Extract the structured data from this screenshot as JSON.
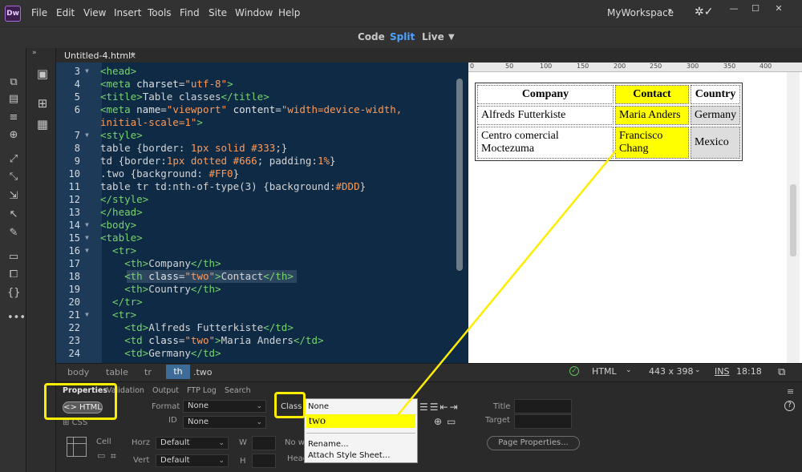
{
  "app": {
    "logo": "Dw",
    "menus": [
      "File",
      "Edit",
      "View",
      "Insert",
      "Tools",
      "Find",
      "Site",
      "Window",
      "Help"
    ],
    "workspace": "MyWorkspace",
    "window_controls": [
      "—",
      "☐",
      "✕"
    ]
  },
  "viewbar": {
    "code": "Code",
    "split": "Split",
    "live": "Live"
  },
  "document": {
    "tab_title": "Untitled-4.html*",
    "close": "×"
  },
  "code_lines": [
    {
      "n": "3"
    },
    {
      "n": "4"
    },
    {
      "n": "5"
    },
    {
      "n": "6"
    },
    {
      "n": ""
    },
    {
      "n": "7"
    },
    {
      "n": "8"
    },
    {
      "n": "9"
    },
    {
      "n": "10"
    },
    {
      "n": "11"
    },
    {
      "n": "12"
    },
    {
      "n": "13"
    },
    {
      "n": "14"
    },
    {
      "n": "15"
    },
    {
      "n": "16"
    },
    {
      "n": "17"
    },
    {
      "n": "18"
    },
    {
      "n": "19"
    },
    {
      "n": "20"
    },
    {
      "n": "21"
    },
    {
      "n": "22"
    },
    {
      "n": "23"
    },
    {
      "n": "24"
    }
  ],
  "code": {
    "l3": "<head>",
    "l4a": "<meta ",
    "l4b": "charset",
    "l4c": "=",
    "l4d": "\"utf-8\"",
    "l4e": ">",
    "l5a": "<title>",
    "l5b": "Table classes",
    "l5c": "</title>",
    "l6a": "<meta ",
    "l6b": "name",
    "l6c": "=",
    "l6d": "\"viewport\"",
    "l6e": " content",
    "l6f": "=",
    "l6g": "\"width=device-width,",
    "l6h": "initial-scale=1\"",
    "l6i": ">",
    "l7": "<style>",
    "l8a": "table {border: ",
    "l8b": "1px solid #333",
    "l8c": ";}",
    "l9a": "td {border:",
    "l9b": "1px dotted #666",
    "l9c": "; padding:",
    "l9d": "1%",
    "l9e": "}",
    "l10a": ".two {background: ",
    "l10b": "#FF0",
    "l10c": "}",
    "l11a": "table tr td:nth-of-type(3) {background:",
    "l11b": "#DDD",
    "l11c": "}",
    "l12": "</style>",
    "l13": "</head>",
    "l14": "<body>",
    "l15": "<table>",
    "l16": "  <tr>",
    "l17a": "    <th>",
    "l17b": "Company",
    "l17c": "</th>",
    "l18a": "    <th ",
    "l18b": "class",
    "l18c": "=",
    "l18d": "\"two\"",
    "l18e": ">",
    "l18f": "Contact",
    "l18g": "</th>",
    "l19a": "    <th>",
    "l19b": "Country",
    "l19c": "</th>",
    "l20": "  </tr>",
    "l21": "  <tr>",
    "l22a": "    <td>",
    "l22b": "Alfreds Futterkiste",
    "l22c": "</td>",
    "l23a": "    <td ",
    "l23b": "class",
    "l23c": "=",
    "l23d": "\"two\"",
    "l23e": ">",
    "l23f": "Maria Anders",
    "l23g": "</td>",
    "l24a": "    <td>",
    "l24b": "Germany",
    "l24c": "</td>"
  },
  "ruler": [
    "0",
    "50",
    "100",
    "150",
    "200",
    "250",
    "300",
    "350",
    "400"
  ],
  "preview": {
    "headers": [
      "Company",
      "Contact",
      "Country"
    ],
    "rows": [
      [
        "Alfreds Futterkiste",
        "Maria Anders",
        "Germany"
      ],
      [
        "Centro comercial Moctezuma",
        "Francisco Chang",
        "Mexico"
      ]
    ]
  },
  "statusbar": {
    "crumbs": [
      "body",
      "table",
      "tr",
      "th",
      ".two"
    ],
    "doctype": "HTML",
    "size": "443 x 398",
    "ins": "INS",
    "position": "18:18"
  },
  "panel": {
    "tabs": [
      "Properties",
      "Validation",
      "Output",
      "FTP Log",
      "Search"
    ],
    "html_pill": "HTML",
    "css_label": "CSS",
    "format_label": "Format",
    "format_value": "None",
    "id_label": "ID",
    "id_value": "None",
    "class_label": "Class",
    "title_label": "Title",
    "target_label": "Target",
    "cell_label": "Cell",
    "horz_label": "Horz",
    "horz_value": "Default",
    "vert_label": "Vert",
    "vert_value": "Default",
    "w_label": "W",
    "h_label": "H",
    "nowrap_label": "No w",
    "header_label": "Head",
    "page_properties": "Page Properties..."
  },
  "class_popup": {
    "items": [
      "None",
      "two",
      "Rename...",
      "Attach Style Sheet..."
    ]
  },
  "colors": {
    "annotation": "#ffee00",
    "highlight": "#ffff00",
    "accent": "#4ea2ff"
  }
}
